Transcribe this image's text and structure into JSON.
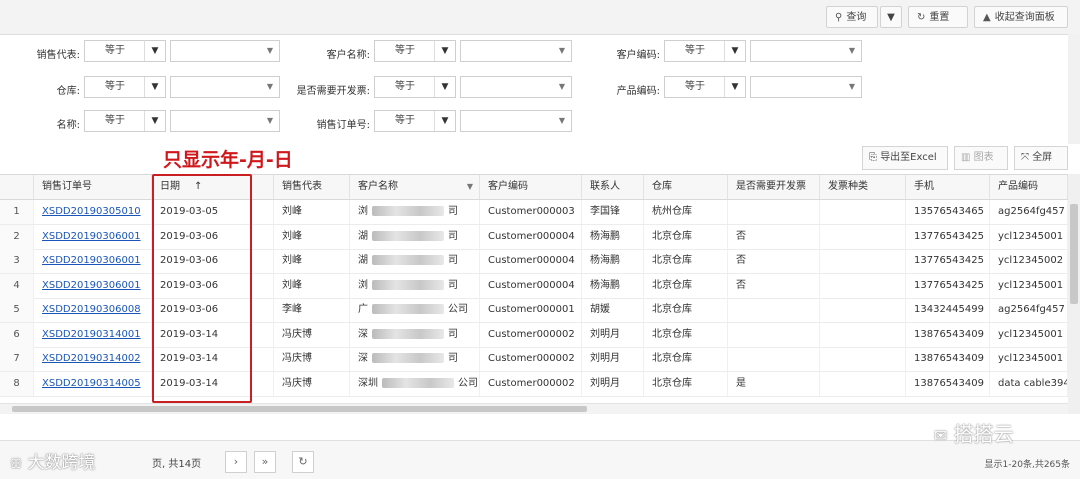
{
  "toolbar": {
    "search_label": "查询",
    "reset_label": "重置",
    "collapse_label": "收起查询面板"
  },
  "filters": {
    "sales_rep_label": "销售代表:",
    "customer_name_label": "客户名称:",
    "customer_code_label": "客户编码:",
    "warehouse_label": "仓库:",
    "need_invoice_label": "是否需要开发票:",
    "product_code_label": "产品编码:",
    "name_label": "名称:",
    "sales_order_label": "销售订单号:",
    "operator_value": "等于"
  },
  "annotation": "只显示年-月-日",
  "grid_actions": {
    "export_label": "导出至Excel",
    "chart_label": "图表",
    "fullscreen_label": "全屏"
  },
  "columns": [
    "销售订单号",
    "日期",
    "销售代表",
    "客户名称",
    "客户编码",
    "联系人",
    "仓库",
    "是否需要开发票",
    "发票种类",
    "手机",
    "产品编码"
  ],
  "sort_arrow": "↑",
  "rows": [
    {
      "n": "1",
      "order": "XSDD20190305010",
      "date": "2019-03-05",
      "rep": "刘峰",
      "cust_a": "浏",
      "cust_b": "司",
      "code": "Customer000003",
      "contact": "李国锋",
      "wh": "杭州仓库",
      "inv": "",
      "invtype": "",
      "phone": "13576543465",
      "product": "ag2564fg457"
    },
    {
      "n": "2",
      "order": "XSDD20190306001",
      "date": "2019-03-06",
      "rep": "刘峰",
      "cust_a": "湖",
      "cust_b": "司",
      "code": "Customer000004",
      "contact": "杨海鹏",
      "wh": "北京仓库",
      "inv": "否",
      "invtype": "",
      "phone": "13776543425",
      "product": "ycl12345001"
    },
    {
      "n": "3",
      "order": "XSDD20190306001",
      "date": "2019-03-06",
      "rep": "刘峰",
      "cust_a": "湖",
      "cust_b": "司",
      "code": "Customer000004",
      "contact": "杨海鹏",
      "wh": "北京仓库",
      "inv": "否",
      "invtype": "",
      "phone": "13776543425",
      "product": "ycl12345002"
    },
    {
      "n": "4",
      "order": "XSDD20190306001",
      "date": "2019-03-06",
      "rep": "刘峰",
      "cust_a": "浏",
      "cust_b": "司",
      "code": "Customer000004",
      "contact": "杨海鹏",
      "wh": "北京仓库",
      "inv": "否",
      "invtype": "",
      "phone": "13776543425",
      "product": "ycl12345001"
    },
    {
      "n": "5",
      "order": "XSDD20190306008",
      "date": "2019-03-06",
      "rep": "李峰",
      "cust_a": "广",
      "cust_b": "公司",
      "code": "Customer000001",
      "contact": "胡媛",
      "wh": "北京仓库",
      "inv": "",
      "invtype": "",
      "phone": "13432445499",
      "product": "ag2564fg457"
    },
    {
      "n": "6",
      "order": "XSDD20190314001",
      "date": "2019-03-14",
      "rep": "冯庆博",
      "cust_a": "深",
      "cust_b": "司",
      "code": "Customer000002",
      "contact": "刘明月",
      "wh": "北京仓库",
      "inv": "",
      "invtype": "",
      "phone": "13876543409",
      "product": "ycl12345001"
    },
    {
      "n": "7",
      "order": "XSDD20190314002",
      "date": "2019-03-14",
      "rep": "冯庆博",
      "cust_a": "深",
      "cust_b": "司",
      "code": "Customer000002",
      "contact": "刘明月",
      "wh": "北京仓库",
      "inv": "",
      "invtype": "",
      "phone": "13876543409",
      "product": "ycl12345001"
    },
    {
      "n": "8",
      "order": "XSDD20190314005",
      "date": "2019-03-14",
      "rep": "冯庆博",
      "cust_a": "深圳",
      "cust_b": "公司",
      "code": "Customer000002",
      "contact": "刘明月",
      "wh": "北京仓库",
      "inv": "是",
      "invtype": "",
      "phone": "13876543409",
      "product": "data cable394"
    }
  ],
  "pagination": {
    "page_text": "页, 共14页",
    "next": "›",
    "last": "»",
    "summary": "显示1-20条,共265条"
  },
  "watermarks": {
    "left": "大数跨境",
    "right": "搭搭云"
  }
}
